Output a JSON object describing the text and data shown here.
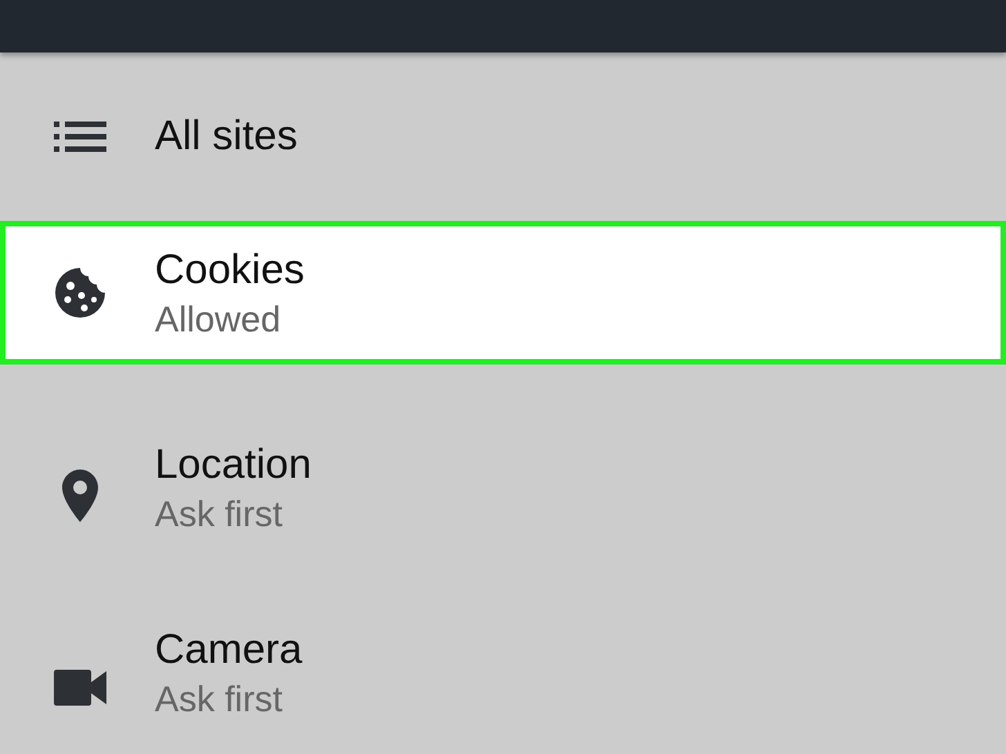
{
  "items": [
    {
      "kind": "list",
      "title": "All sites",
      "selected": false
    },
    {
      "kind": "cookie",
      "title": "Cookies",
      "subtitle": "Allowed",
      "selected": true
    },
    {
      "kind": "location",
      "title": "Location",
      "subtitle": "Ask first",
      "selected": false
    },
    {
      "kind": "camera",
      "title": "Camera",
      "subtitle": "Ask first",
      "selected": false
    }
  ]
}
